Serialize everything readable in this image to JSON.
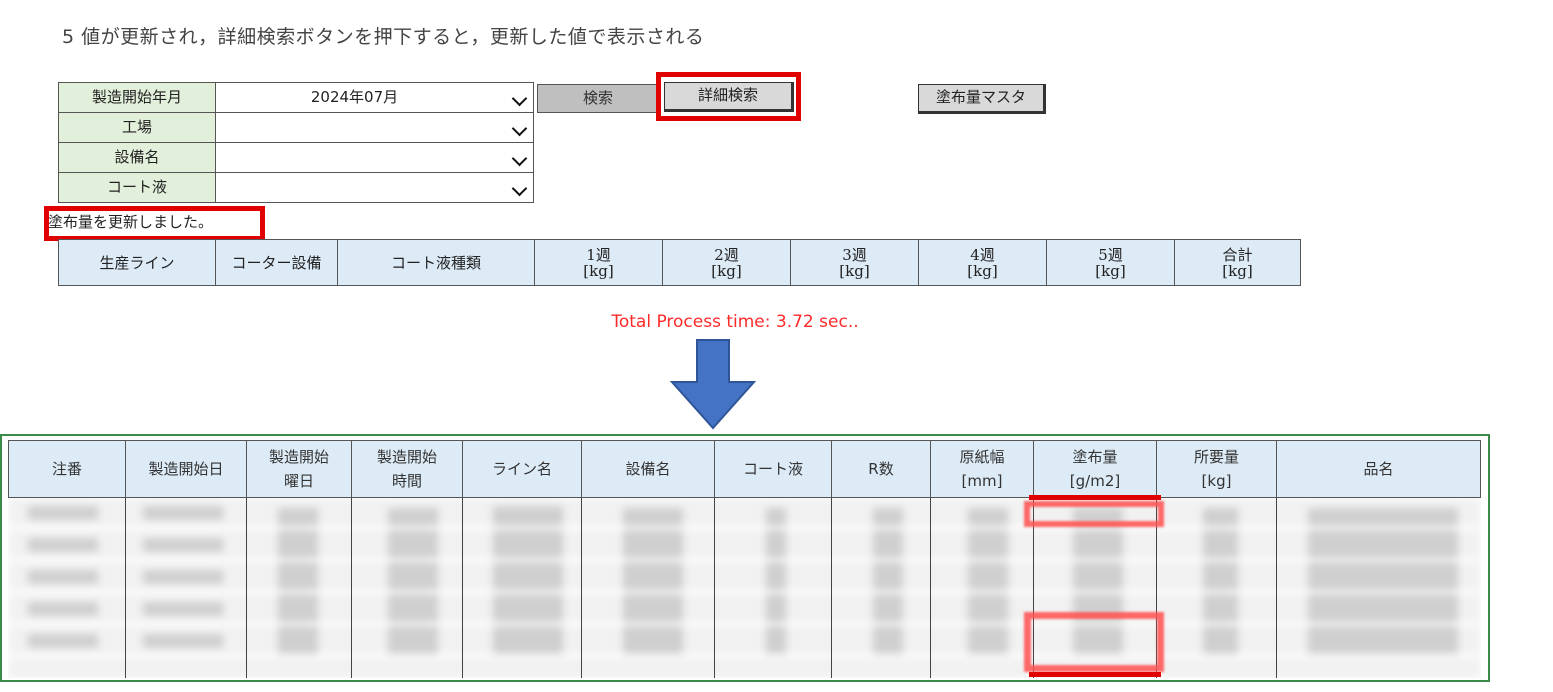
{
  "step_text": "5 値が更新され，詳細検索ボタンを押下すると，更新した値で表示される",
  "filters": [
    {
      "label": "製造開始年月",
      "value": "2024年07月"
    },
    {
      "label": "工場",
      "value": ""
    },
    {
      "label": "設備名",
      "value": ""
    },
    {
      "label": "コート液",
      "value": ""
    }
  ],
  "buttons": {
    "search": "検索",
    "detail_search": "詳細検索",
    "master": "塗布量マスタ"
  },
  "message": "塗布量を更新しました。",
  "summary_headers": [
    "生産ライン",
    "コーター設備",
    "コート液種類",
    "1週\n[kg]",
    "2週\n[kg]",
    "3週\n[kg]",
    "4週\n[kg]",
    "5週\n[kg]",
    "合計\n[kg]"
  ],
  "summary_header_parts": [
    {
      "a": "生産ライン",
      "b": ""
    },
    {
      "a": "コーター設備",
      "b": ""
    },
    {
      "a": "コート液種類",
      "b": ""
    },
    {
      "a": "1週",
      "b": "[kg]"
    },
    {
      "a": "2週",
      "b": "[kg]"
    },
    {
      "a": "3週",
      "b": "[kg]"
    },
    {
      "a": "4週",
      "b": "[kg]"
    },
    {
      "a": "5週",
      "b": "[kg]"
    },
    {
      "a": "合計",
      "b": "[kg]"
    }
  ],
  "process_time": "Total Process time: 3.72 sec..",
  "detail_headers": [
    {
      "a": "注番",
      "b": ""
    },
    {
      "a": "製造開始日",
      "b": ""
    },
    {
      "a": "製造開始",
      "b": "曜日"
    },
    {
      "a": "製造開始",
      "b": "時間"
    },
    {
      "a": "ライン名",
      "b": ""
    },
    {
      "a": "設備名",
      "b": ""
    },
    {
      "a": "コート液",
      "b": ""
    },
    {
      "a": "R数",
      "b": ""
    },
    {
      "a": "原紙幅",
      "b": "[mm]"
    },
    {
      "a": "塗布量",
      "b": "[g/m2]"
    },
    {
      "a": "所要量",
      "b": "[kg]"
    },
    {
      "a": "品名",
      "b": ""
    }
  ],
  "colors": {
    "highlight_red": "#e00000",
    "arrow_blue": "#4472c4",
    "process_text": "#ff2a2a",
    "label_green": "#e2efda",
    "header_blue": "#ddebf7"
  },
  "icons": {
    "dropdown": "chevron-down-icon",
    "arrow": "arrow-down-icon"
  }
}
